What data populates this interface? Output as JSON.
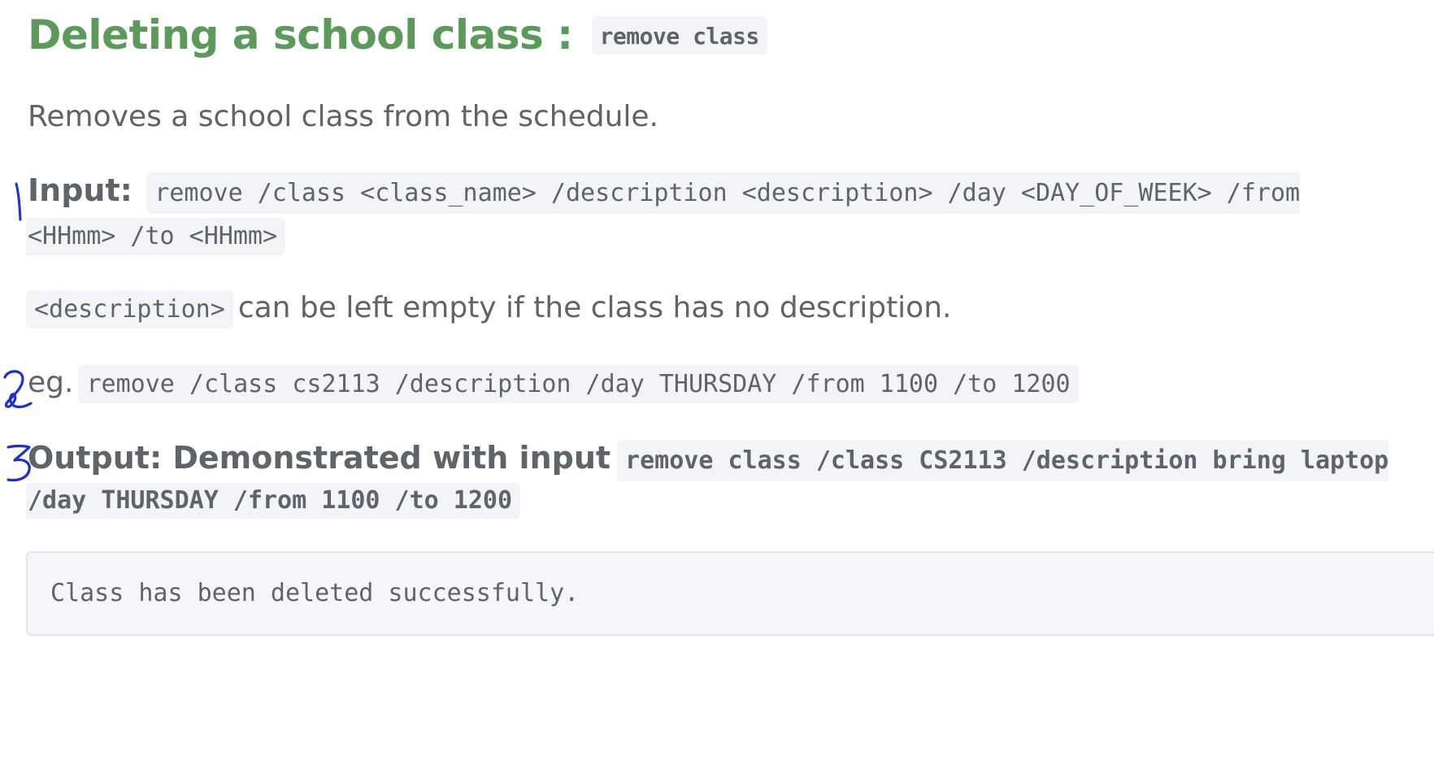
{
  "heading": {
    "title": "Deleting a school class :",
    "command": "remove class"
  },
  "summary": "Removes a school class from the schedule.",
  "input": {
    "label": "Input:",
    "format_part1": "remove /class <class_name> /description <description> /day <DAY_OF_WEEK> /from",
    "format_part2": "<HHmm> /to <HHmm>"
  },
  "description_note": {
    "code": "<description>",
    "text": "can be left empty if the class has no description."
  },
  "example": {
    "prefix": "eg.",
    "command": "remove /class cs2113 /description /day THURSDAY /from 1100 /to 1200"
  },
  "output": {
    "label": "Output: Demonstrated with input",
    "input_part1": "remove class /class CS2113 /description bring laptop",
    "input_part2": "/day THURSDAY /from 1100 /to 1200",
    "result": "Class has been deleted successfully."
  },
  "annotations": {
    "color": "#1a2fd6",
    "marks": [
      "1",
      "2",
      "3"
    ]
  }
}
